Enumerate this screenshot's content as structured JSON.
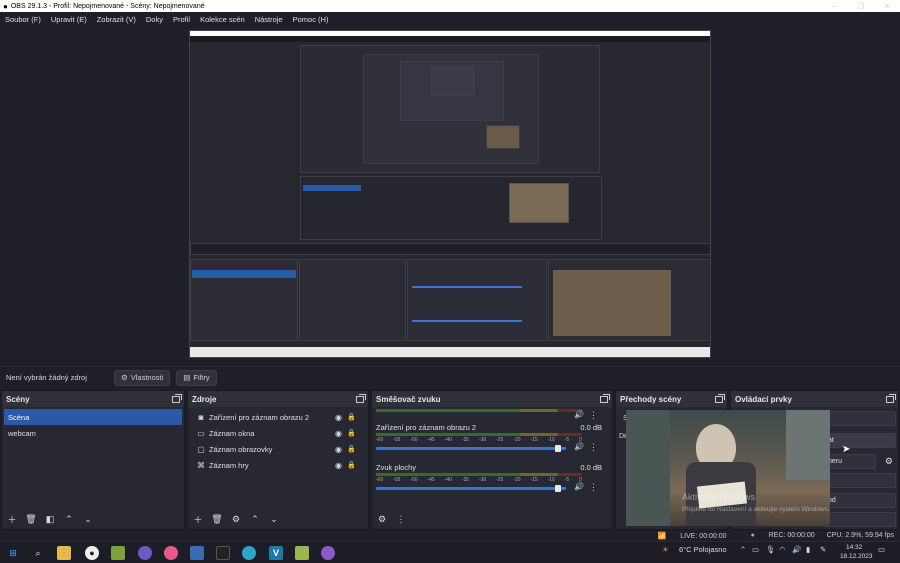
{
  "window": {
    "title": "OBS 29.1.3 - Profil: Nepojmenované - Scény: Nepojmenované"
  },
  "menu": [
    "Soubor (F)",
    "Upravit (E)",
    "Zobrazit (V)",
    "Doky",
    "Profil",
    "Kolekce scén",
    "Nástroje",
    "Pomoc (H)"
  ],
  "context": {
    "none_selected": "Není vybrán žádný zdroj",
    "properties": "Vlastnosti",
    "filters": "Filtry"
  },
  "scenes": {
    "title": "Scény",
    "items": [
      "Scéna",
      "webcam"
    ],
    "selected": 0
  },
  "sources": {
    "title": "Zdroje",
    "items": [
      {
        "name": "Zařízení pro záznam obrazu 2",
        "icon": "camera-icon"
      },
      {
        "name": "Záznam okna",
        "icon": "window-icon"
      },
      {
        "name": "Záznam obrazovky",
        "icon": "monitor-icon"
      },
      {
        "name": "Záznam hry",
        "icon": "gamepad-icon"
      }
    ]
  },
  "mixer": {
    "title": "Směšovač zvuku",
    "channels": [
      {
        "name": "Zařízení pro záznam obrazu 2",
        "db": "0.0 dB"
      },
      {
        "name": "Zvuk plochy",
        "db": "0.0 dB"
      }
    ],
    "scale": [
      "-60",
      "-55",
      "-50",
      "-45",
      "-40",
      "-35",
      "-30",
      "-25",
      "-20",
      "-15",
      "-10",
      "-5",
      "0"
    ]
  },
  "transitions": {
    "title": "Přechody scény",
    "hint1": "S",
    "hint2": "Dél",
    "watermark1": "Aktivujte Windows",
    "watermark2": "Přejděte do Nastavení a aktivujte systém Windows."
  },
  "controls": {
    "title": "Ovládací prvky",
    "b1": "at",
    "b2": "heru",
    "b3": "od"
  },
  "status": {
    "live": "LIVE: 00:00:00",
    "rec": "REC: 00:00:00",
    "cpu": "CPU: 2.9%, 59.94 fps"
  },
  "taskbar": {
    "weather": "6°C Polojasno",
    "time": "14:32",
    "date": "18.12.2023"
  }
}
